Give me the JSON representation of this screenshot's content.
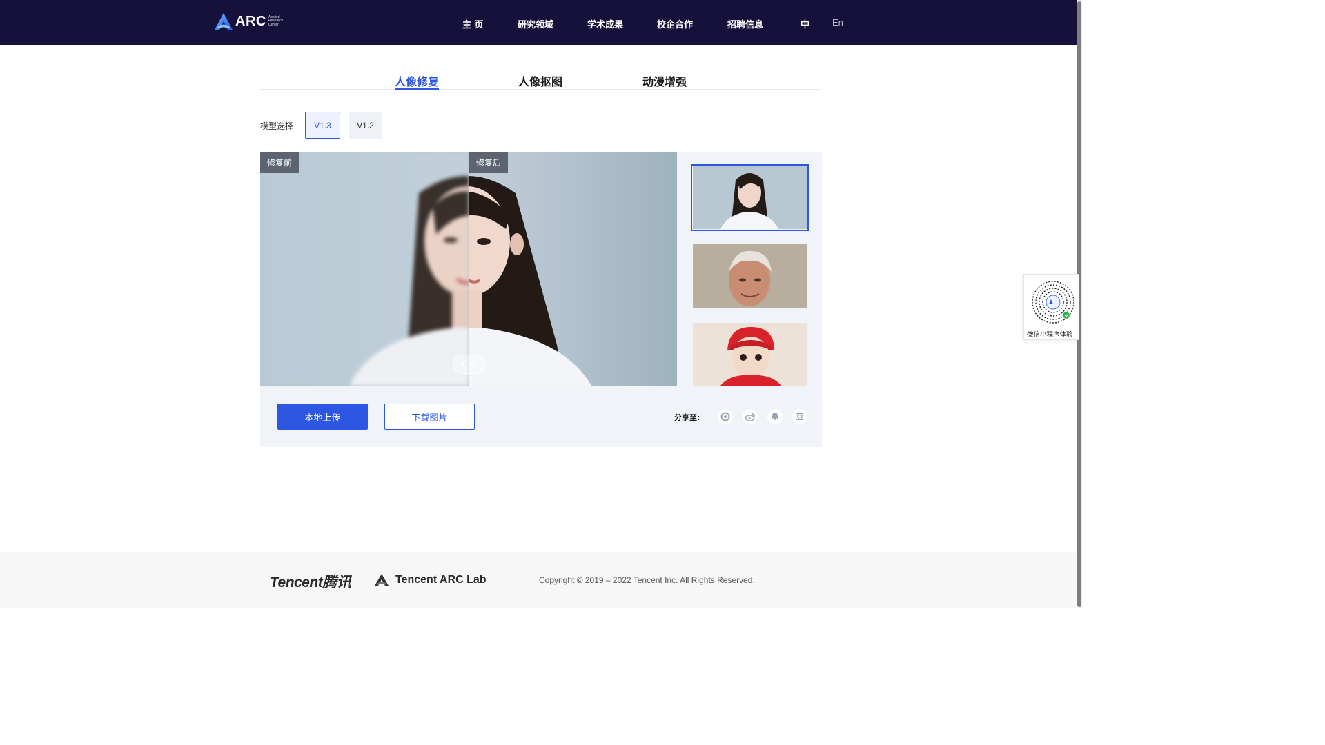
{
  "header": {
    "logo_text": "ARC",
    "logo_sub": [
      "Applied",
      "Research",
      "Center"
    ],
    "nav": [
      "主 页",
      "研究领域",
      "学术成果",
      "校企合作",
      "招聘信息"
    ],
    "lang_zh": "中",
    "lang_en": "En"
  },
  "tabs": [
    {
      "label": "人像修复",
      "active": true
    },
    {
      "label": "人像抠图",
      "active": false
    },
    {
      "label": "动漫增强",
      "active": false
    }
  ],
  "model": {
    "label": "模型选择",
    "options": [
      "V1.3",
      "V1.2"
    ],
    "selected": "V1.3"
  },
  "viewer": {
    "before_label": "修复前",
    "after_label": "修复后",
    "split_fraction": 0.5,
    "thumbnails": [
      "young-woman-portrait",
      "older-man-portrait",
      "child-red-hat-portrait"
    ],
    "selected_thumbnail": 0
  },
  "actions": {
    "upload": "本地上传",
    "download": "下载图片",
    "share_label": "分享至:",
    "share_targets": [
      "wechat-moments-icon",
      "weibo-icon",
      "qq-icon",
      "douban-icon"
    ],
    "douban_glyph": "豆"
  },
  "qr": {
    "label": "微信小程序体验"
  },
  "footer": {
    "tencent": "Tencent腾讯",
    "arc_lab": "Tencent ARC Lab",
    "copyright": "Copyright © 2019 – 2022 Tencent Inc. All Rights Reserved."
  },
  "colors": {
    "header_bg": "#15113a",
    "accent": "#2d56e3",
    "panel_bg": "#f0f3f8"
  }
}
